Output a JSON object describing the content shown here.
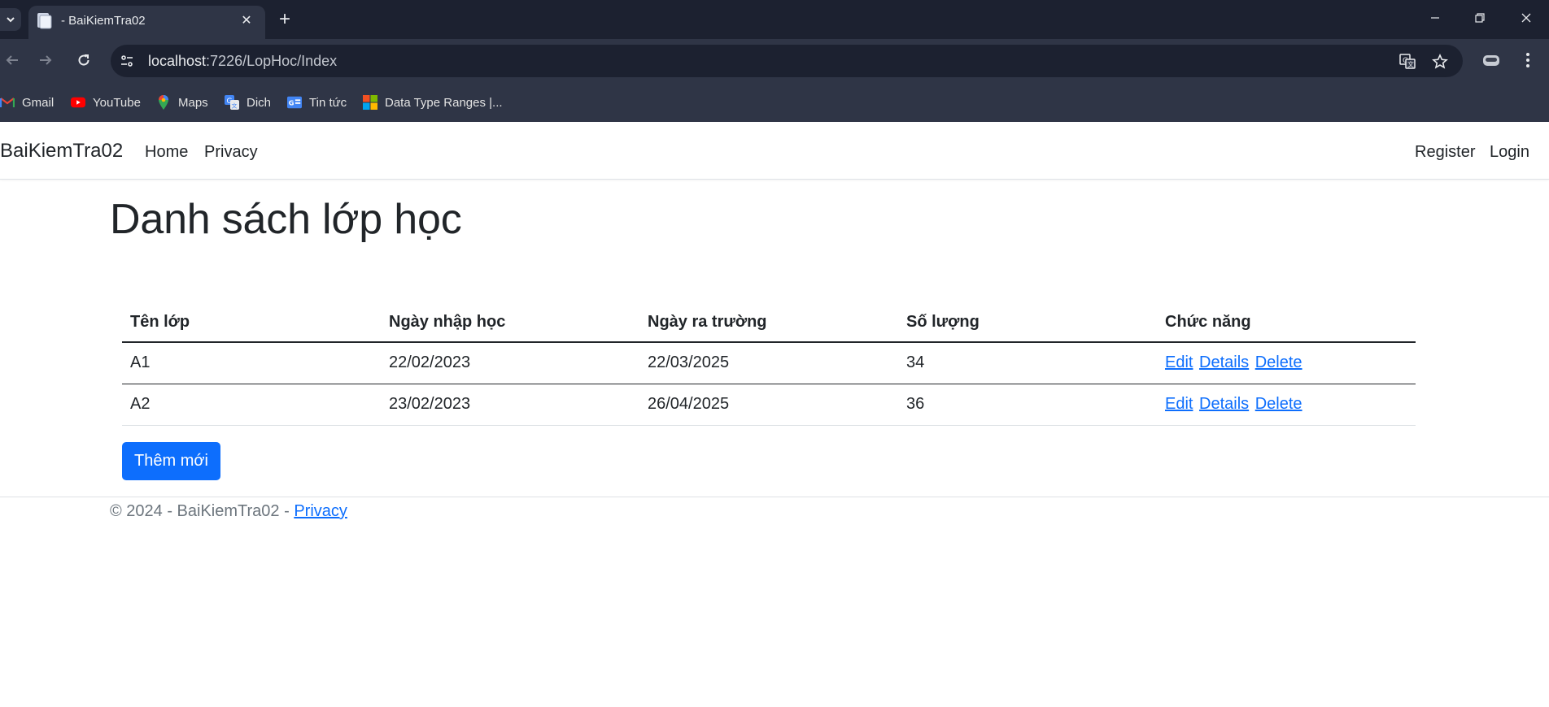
{
  "browser": {
    "tab_title": "- BaiKiemTra02",
    "url_host": "localhost",
    "url_path": ":7226/LopHoc/Index",
    "bookmarks": [
      {
        "label": "Gmail",
        "icon": "gmail-icon"
      },
      {
        "label": "YouTube",
        "icon": "youtube-icon"
      },
      {
        "label": "Maps",
        "icon": "maps-icon"
      },
      {
        "label": "Dich",
        "icon": "translate-icon"
      },
      {
        "label": "Tin tức",
        "icon": "news-icon"
      },
      {
        "label": "Data Type Ranges |...",
        "icon": "microsoft-icon"
      }
    ]
  },
  "navbar": {
    "brand": "BaiKiemTra02",
    "links": [
      "Home",
      "Privacy"
    ],
    "right_links": [
      "Register",
      "Login"
    ]
  },
  "page": {
    "title": "Danh sách lớp học",
    "table": {
      "headers": [
        "Tên lớp",
        "Ngày nhập học",
        "Ngày ra trường",
        "Số lượng",
        "Chức năng"
      ],
      "rows": [
        {
          "ten_lop": "A1",
          "ngay_nhap_hoc": "22/02/2023",
          "ngay_ra_truong": "22/03/2025",
          "so_luong": "34"
        },
        {
          "ten_lop": "A2",
          "ngay_nhap_hoc": "23/02/2023",
          "ngay_ra_truong": "26/04/2025",
          "so_luong": "36"
        }
      ],
      "actions": [
        "Edit",
        "Details",
        "Delete"
      ]
    },
    "add_button": "Thêm mới"
  },
  "footer": {
    "text": "© 2024 - BaiKiemTra02 - ",
    "link": "Privacy"
  },
  "colors": {
    "primary": "#0d6efd",
    "chrome_dark": "#1c2130",
    "chrome_toolbar": "#2f3546",
    "text": "#212529",
    "muted": "#6c757d"
  }
}
